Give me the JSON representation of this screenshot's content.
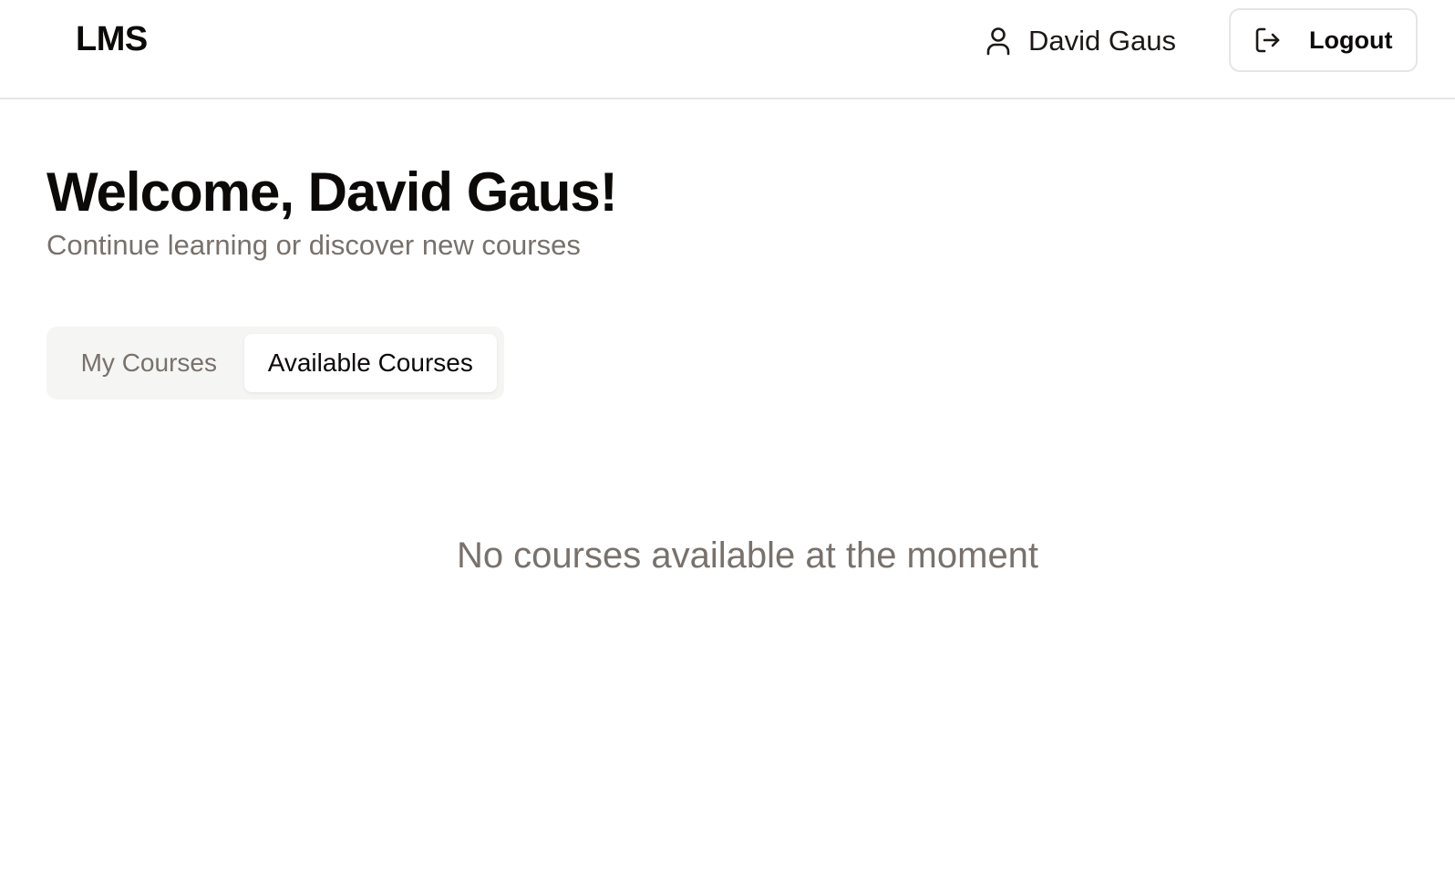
{
  "app": {
    "brand": "LMS"
  },
  "header": {
    "user": {
      "name": "David Gaus",
      "icon": "user-icon"
    },
    "logout": {
      "label": "Logout",
      "icon": "logout-icon"
    }
  },
  "main": {
    "welcome": "Welcome, David Gaus!",
    "subtitle": "Continue learning or discover new courses",
    "tabs": [
      {
        "label": "My Courses",
        "active": false
      },
      {
        "label": "Available Courses",
        "active": true
      }
    ],
    "empty_message": "No courses available at the moment"
  },
  "colors": {
    "text": "#0c0a09",
    "muted": "#78716c",
    "border": "#e7e5e4",
    "tab_bg": "#f5f5f4"
  }
}
